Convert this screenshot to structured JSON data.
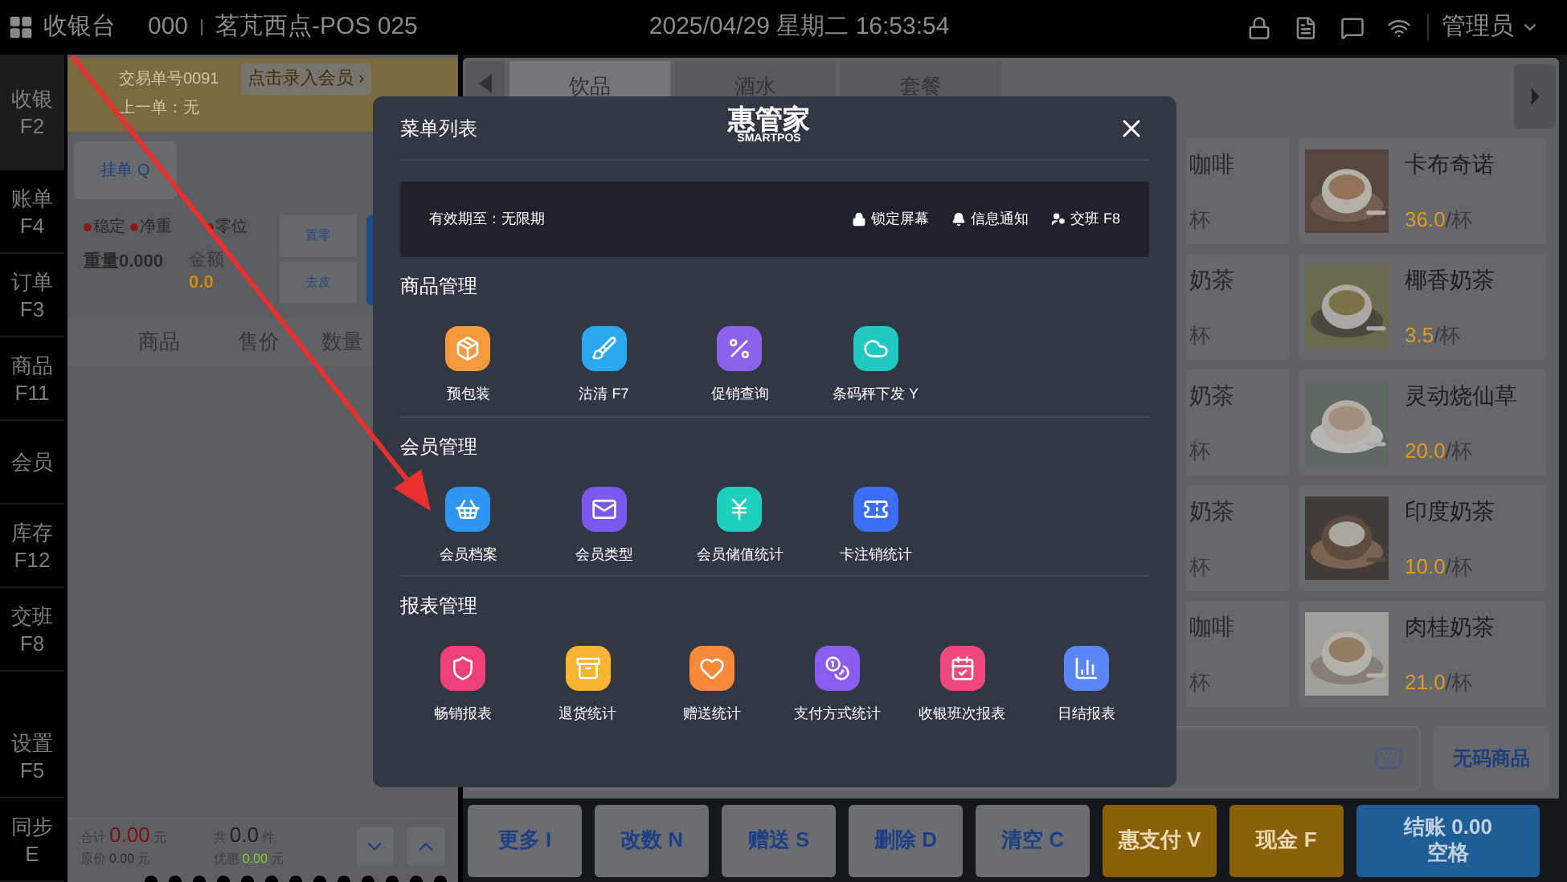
{
  "top_bar": {
    "app_title": "收银台",
    "terminal": "000",
    "store": "茗芃西点-POS 025",
    "datetime": "2025/04/29 星期二 16:53:54",
    "user": "管理员"
  },
  "sidebar": {
    "items": [
      {
        "label": "收银",
        "key": "F2",
        "selected": true
      },
      {
        "label": "账单",
        "key": "F4",
        "selected": false
      },
      {
        "label": "订单",
        "key": "F3",
        "selected": false
      },
      {
        "label": "商品",
        "key": "F11",
        "selected": false
      },
      {
        "label": "会员",
        "selected": false
      },
      {
        "label": "库存",
        "key": "F12",
        "selected": false
      },
      {
        "label": "交班",
        "key": "F8",
        "selected": false
      }
    ],
    "bottom_items": [
      {
        "label": "设置",
        "key": "F5",
        "selected": false
      },
      {
        "label": "同步",
        "key": "E",
        "selected": false
      }
    ]
  },
  "order": {
    "trade_no": "交易单号0091",
    "last_order": "上一单：无",
    "member_button": "点击录入会员 ›",
    "hold_button": "挂单 Q",
    "scale_status": [
      "稳定",
      "净重",
      "零位"
    ],
    "weight": "重量0.000",
    "amount_label": "金额",
    "amount": "0.0",
    "zero_button": "置零",
    "tare_button": "去皮",
    "columns": [
      "商品",
      "售价",
      "数量"
    ],
    "total_label": "合计",
    "total": "0.00",
    "total_unit": "元",
    "original_label": "原价",
    "original": "0.00",
    "original_unit": "元",
    "count_label": "共",
    "count": "0.0",
    "count_unit": "件",
    "discount_label": "优惠",
    "discount": "0.00",
    "discount_unit": "元"
  },
  "categories": {
    "tabs": [
      {
        "label": "饮品",
        "selected": true
      },
      {
        "label": "酒水",
        "selected": false
      },
      {
        "label": "套餐",
        "selected": false
      }
    ]
  },
  "products": [
    [
      {
        "name": "咖啡",
        "unit": "杯"
      },
      {
        "name": "卡布奇诺",
        "price": "36.0",
        "unit": "/杯"
      }
    ],
    [
      {
        "name": "奶茶",
        "unit": "杯"
      },
      {
        "name": "椰香奶茶",
        "price": "3.5",
        "unit": "/杯"
      }
    ],
    [
      {
        "name": "奶茶",
        "unit": "杯"
      },
      {
        "name": "灵动烧仙草",
        "price": "20.0",
        "unit": "/杯"
      }
    ],
    [
      {
        "name": "奶茶",
        "unit": "杯"
      },
      {
        "name": "印度奶茶",
        "price": "10.0",
        "unit": "/杯"
      }
    ],
    [
      {
        "name": "咖啡",
        "unit": "杯"
      },
      {
        "name": "肉桂奶茶",
        "price": "21.0",
        "unit": "/杯"
      }
    ]
  ],
  "no_code_button": "无码商品",
  "actions": [
    {
      "label": "更多 I",
      "kind": "plain"
    },
    {
      "label": "改数 N",
      "kind": "plain"
    },
    {
      "label": "赠送 S",
      "kind": "plain"
    },
    {
      "label": "删除 D",
      "kind": "plain"
    },
    {
      "label": "清空 C",
      "kind": "plain"
    },
    {
      "label": "惠支付 V",
      "kind": "pay"
    },
    {
      "label": "现金 F",
      "kind": "pay"
    },
    {
      "label": "结账 0.00\n空格",
      "kind": "checkout"
    }
  ],
  "menu_dialog": {
    "title": "菜单列表",
    "logo": "惠管家",
    "logo_sub": "SMARTPOS",
    "validity": "有效期至：无限期",
    "quick_actions": [
      {
        "label": "锁定屏幕",
        "kind": "lock"
      },
      {
        "label": "信息通知",
        "kind": "bell"
      },
      {
        "label": "交班 F8",
        "kind": "user"
      }
    ],
    "sections": [
      {
        "title": "商品管理",
        "items": [
          {
            "label": "预包装",
            "color": "#f39a3c",
            "kind": "box"
          },
          {
            "label": "沽清 F7",
            "color": "#2aa8f0",
            "kind": "brush"
          },
          {
            "label": "促销查询",
            "color": "#8a63ea",
            "kind": "percent"
          },
          {
            "label": "条码秤下发 Y",
            "color": "#20c9c2",
            "kind": "cloud"
          }
        ]
      },
      {
        "title": "会员管理",
        "items": [
          {
            "label": "会员档案",
            "color": "#2f95f2",
            "kind": "basket"
          },
          {
            "label": "会员类型",
            "color": "#7b58ee",
            "kind": "mail"
          },
          {
            "label": "会员储值统计",
            "color": "#1fcfbd",
            "kind": "yen"
          },
          {
            "label": "卡注销统计",
            "color": "#3a6ff5",
            "kind": "ticket"
          }
        ]
      },
      {
        "title": "报表管理",
        "items": [
          {
            "label": "畅销报表",
            "color": "#f0407a",
            "kind": "shield"
          },
          {
            "label": "退货统计",
            "color": "#f7b531",
            "kind": "package"
          },
          {
            "label": "赠送统计",
            "color": "#f78a3a",
            "kind": "heart"
          },
          {
            "label": "支付方式统计",
            "color": "#8b5cf0",
            "kind": "coins"
          },
          {
            "label": "收银班次报表",
            "color": "#f0477c",
            "kind": "calendar"
          },
          {
            "label": "日结报表",
            "color": "#5b86f5",
            "kind": "chart"
          }
        ]
      }
    ]
  }
}
